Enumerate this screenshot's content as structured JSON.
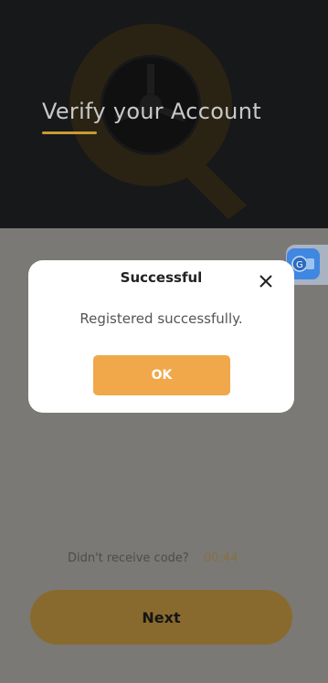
{
  "header": {
    "title": "Verify your Account",
    "logo_icon": "steering-wheel-logo"
  },
  "modal": {
    "title": "Successful",
    "message": "Registered successfully.",
    "ok_label": "OK",
    "close_icon": "close-icon"
  },
  "resend": {
    "label": "Didn't receive code?",
    "timer": "00:44"
  },
  "next_label": "Next",
  "translate_icon": "translate-icon",
  "colors": {
    "accent": "#f1a84b",
    "accent_dim": "#896a2e",
    "header_bg": "#171819",
    "overlay_bg": "#7b7976"
  }
}
